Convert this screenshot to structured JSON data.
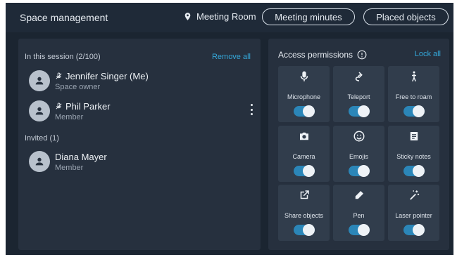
{
  "header": {
    "title": "Space management",
    "location": "Meeting Room",
    "minutes_button": "Meeting minutes",
    "placed_button": "Placed objects"
  },
  "session": {
    "heading": "In this session (2/100)",
    "remove_all": "Remove all",
    "members": [
      {
        "name": "Jennifer Singer (Me)",
        "role": "Space owner"
      },
      {
        "name": "Phil Parker",
        "role": "Member"
      }
    ]
  },
  "invited": {
    "heading": "Invited (1)",
    "members": [
      {
        "name": "Diana Mayer",
        "role": "Member"
      }
    ]
  },
  "permissions": {
    "title": "Access permissions",
    "lock_all": "Lock all",
    "items": [
      {
        "label": "Microphone",
        "icon": "microphone-icon",
        "enabled": true
      },
      {
        "label": "Teleport",
        "icon": "teleport-icon",
        "enabled": true
      },
      {
        "label": "Free to roam",
        "icon": "walking-person-icon",
        "enabled": true
      },
      {
        "label": "Camera",
        "icon": "camera-icon",
        "enabled": true
      },
      {
        "label": "Emojis",
        "icon": "smiley-icon",
        "enabled": true
      },
      {
        "label": "Sticky notes",
        "icon": "note-icon",
        "enabled": true
      },
      {
        "label": "Share objects",
        "icon": "share-icon",
        "enabled": true
      },
      {
        "label": "Pen",
        "icon": "pen-icon",
        "enabled": true
      },
      {
        "label": "Laser pointer",
        "icon": "magic-wand-icon",
        "enabled": true
      }
    ]
  },
  "colors": {
    "background": "#1b2531",
    "panel": "#26303e",
    "tile": "#313d4c",
    "accent": "#34a7d9",
    "toggle_on": "#2b86b8"
  }
}
